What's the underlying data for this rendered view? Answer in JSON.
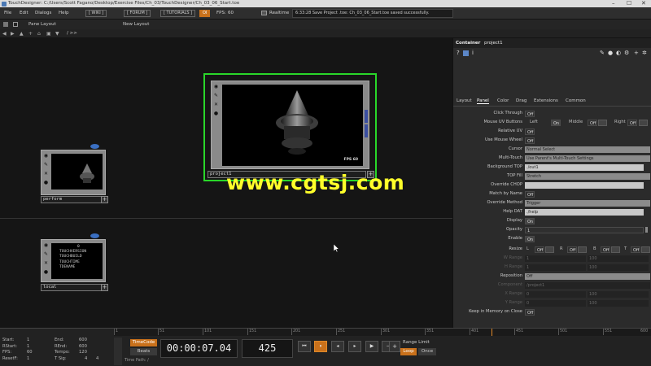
{
  "app_title": "TouchDesigner: C:/Users/Scott Fagano/Desktop/Exercise Files/Ch_03/TouchDesigner/Ch_03_06_Start.toe",
  "window_controls": {
    "minimize": "–",
    "maximize": "☐",
    "close": "✕"
  },
  "menu": [
    "File",
    "Edit",
    "Dialogs",
    "Help"
  ],
  "toolbar": {
    "wiki": "[ WIKI ]",
    "forum": "[ FORUM ]",
    "tutorials": "[ TUTORIALS ]",
    "oi": "OI",
    "fps_label": "FPS:",
    "fps_value": "60",
    "realtime": "Realtime",
    "status": "6:33:28 Save Project .toe: Ch_03_06_Start.toe saved successfully."
  },
  "pane_bar": {
    "pane_layout": "Pane Layout",
    "new_layout": "New Layout"
  },
  "path_bar": "/ >>",
  "nodes": {
    "project": {
      "name": "project1",
      "fps": "FPS 60"
    },
    "perform": {
      "name": "perform"
    },
    "local": {
      "name": "local",
      "variables": [
        "0",
        "TOUCHVERSION",
        "TOUCHBUILD",
        "TOUCHTIME",
        "TDENAME"
      ]
    }
  },
  "panel": {
    "header_type": "Container",
    "header_name": "project1",
    "tabs": [
      "Layout",
      "Panel",
      "Color",
      "Drag",
      "Extensions",
      "Common"
    ],
    "active_tab": "Panel",
    "params": {
      "click_through": {
        "label": "Click Through",
        "value": "Off"
      },
      "mouse_uv": {
        "label": "Mouse UV Buttons",
        "left": "Left",
        "left_val": "On",
        "middle": "Middle",
        "middle_val": "Off",
        "right": "Right",
        "right_val": "Off"
      },
      "relative_uv": {
        "label": "Relative UV",
        "value": "Off"
      },
      "mouse_wheel": {
        "label": "Use Mouse Wheel",
        "value": "Off"
      },
      "cursor": {
        "label": "Cursor",
        "value": "Normal Select"
      },
      "multitouch": {
        "label": "Multi-Touch",
        "value": "Use Parent's Multi-Touch Settings"
      },
      "bg_top": {
        "label": "Background TOP",
        "value": "./out1"
      },
      "top_fill": {
        "label": "TOP Fill",
        "value": "Stretch"
      },
      "override_chop": {
        "label": "Override CHOP",
        "value": ""
      },
      "match_name": {
        "label": "Match by Name",
        "value": "Off"
      },
      "override_method": {
        "label": "Override Method",
        "value": "Trigger"
      },
      "help_dat": {
        "label": "Help DAT",
        "value": "./help"
      },
      "display": {
        "label": "Display",
        "value": "On"
      },
      "opacity": {
        "label": "Opacity",
        "value": "1"
      },
      "enable": {
        "label": "Enable",
        "value": "On"
      },
      "resize": {
        "label": "Resize",
        "l": "L",
        "l_val": "Off",
        "r": "R",
        "r_val": "Off",
        "b": "B",
        "b_val": "Off",
        "t": "T",
        "t_val": "Off"
      },
      "w_range": {
        "label": "W Range",
        "a": "1",
        "b": "100"
      },
      "h_range": {
        "label": "H Range",
        "a": "1",
        "b": "100"
      },
      "reposition": {
        "label": "Reposition",
        "value": "Off"
      },
      "component": {
        "label": "Component",
        "value": "/project1"
      },
      "x_range": {
        "label": "X Range",
        "a": "0",
        "b": "100"
      },
      "y_range": {
        "label": "Y Range",
        "a": "0",
        "b": "100"
      },
      "keep_memory": {
        "label": "Keep in Memory on Close",
        "value": "Off"
      }
    }
  },
  "timeline": {
    "ticks": [
      "1",
      "51",
      "101",
      "151",
      "201",
      "251",
      "301",
      "351",
      "401",
      "451",
      "501",
      "551",
      "600"
    ],
    "info": {
      "start_l": "Start:",
      "start_v": "1",
      "end_l": "End:",
      "end_v": "600",
      "rstart_l": "RStart:",
      "rstart_v": "1",
      "rend_l": "REnd:",
      "rend_v": "600",
      "fps_l": "FPS:",
      "fps_v": "60",
      "tempo_l": "Tempo:",
      "tempo_v": "120",
      "resetf_l": "ResetF:",
      "resetf_v": "1",
      "tsig_l": "T Sig:",
      "tsig_a": "4",
      "tsig_b": "4"
    },
    "timecode_label": "TimeCode",
    "beats_label": "Beats",
    "timecode": "00:00:07.04",
    "frame": "425",
    "range_limit": "Range Limit",
    "loop": "Loop",
    "once": "Once",
    "time_path": "Time Path: /"
  },
  "watermark": "www.cgtsj.com",
  "colors": {
    "accent_green": "#29d629",
    "watermark_yellow": "#ffff2a",
    "node_bubble": "#3a6fc2"
  }
}
